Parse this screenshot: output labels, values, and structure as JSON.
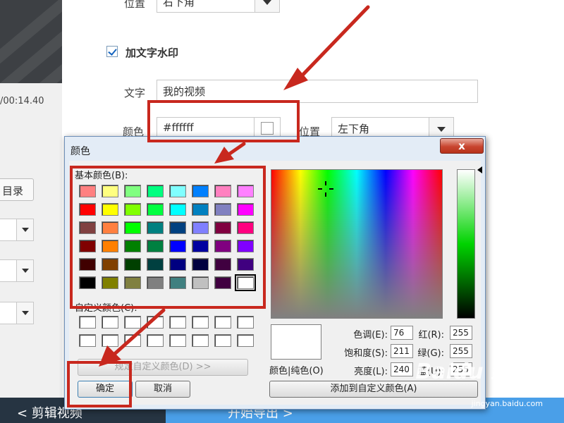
{
  "app": {
    "position_label": "位置",
    "position_value_top": "右下角",
    "add_text_watermark_label": "加文字水印",
    "add_text_watermark_checked": true,
    "text_label": "文字",
    "text_value": "我的视频",
    "color_label": "颜色",
    "color_value": "#ffffff",
    "position2_label": "位置",
    "position2_value": "左下角",
    "timecode": "/00:14.40",
    "directory_button": "目录",
    "bottom_left_label": "< 剪辑视频",
    "bottom_right_label": "开始导出 >"
  },
  "dialog": {
    "title": "颜色",
    "close_label": "x",
    "basic_colors_label": "基本颜色(B):",
    "basic_colors": [
      "#ff8080",
      "#ffff80",
      "#80ff80",
      "#00ff80",
      "#80ffff",
      "#0080ff",
      "#ff80c0",
      "#ff80ff",
      "#ff0000",
      "#ffff00",
      "#80ff00",
      "#00ff40",
      "#00ffff",
      "#0080c0",
      "#8080c0",
      "#ff00ff",
      "#804040",
      "#ff8040",
      "#00ff00",
      "#008080",
      "#004080",
      "#8080ff",
      "#800040",
      "#ff0080",
      "#800000",
      "#ff8000",
      "#008000",
      "#008040",
      "#0000ff",
      "#0000a0",
      "#800080",
      "#8000ff",
      "#400000",
      "#804000",
      "#004000",
      "#004040",
      "#000080",
      "#000040",
      "#400040",
      "#400080",
      "#000000",
      "#808000",
      "#808040",
      "#808080",
      "#408080",
      "#c0c0c0",
      "#400040",
      "#ffffff"
    ],
    "selected_index": 47,
    "custom_colors_label": "自定义颜色(C):",
    "define_custom_button": "规定自定义颜色(D) >>",
    "ok_button": "确定",
    "cancel_button": "取消",
    "color_solid_label": "颜色|纯色(O)",
    "hue_label": "色调(E):",
    "hue_value": "76",
    "sat_label": "饱和度(S):",
    "sat_value": "211",
    "lum_label": "亮度(L):",
    "lum_value": "240",
    "red_label": "红(R):",
    "red_value": "255",
    "green_label": "绿(G):",
    "green_value": "255",
    "blue_label": "蓝(U):",
    "blue_value": "255",
    "add_custom_button": "添加到自定义颜色(A)"
  },
  "watermark": {
    "logo_text": "Baidu 经验",
    "url_text": "jingyan.baidu.com"
  },
  "colors": {
    "annotation_red": "#c8281e",
    "export_blue": "#4a9fe8",
    "dialog_frame": "#e3ecf6"
  }
}
